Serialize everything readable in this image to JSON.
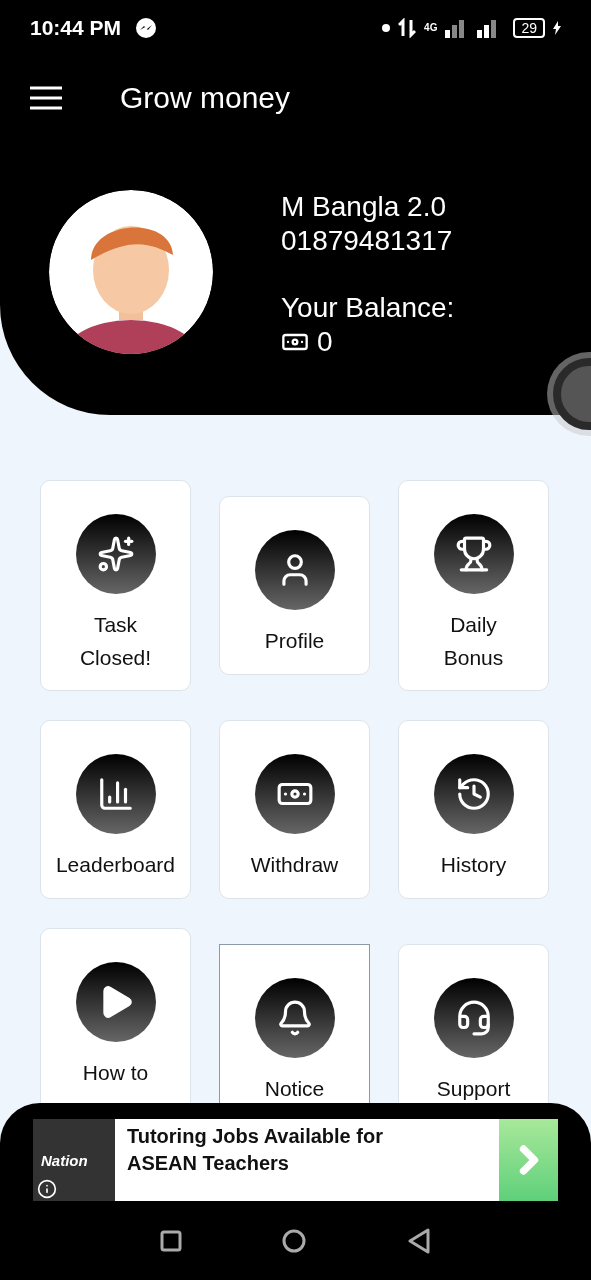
{
  "status_bar": {
    "time": "10:44 PM",
    "network": "4G",
    "battery": "29"
  },
  "app_bar": {
    "title": "Grow money"
  },
  "profile": {
    "name": "M Bangla 2.0",
    "phone": "01879481317",
    "balance_label": "Your Balance:",
    "balance": "0"
  },
  "menu": [
    {
      "label": "Task Closed!",
      "kind": "tall"
    },
    {
      "label": "Profile",
      "kind": "short"
    },
    {
      "label": "Daily Bonus",
      "kind": "tall"
    },
    {
      "label": "Leaderboard",
      "kind": "short"
    },
    {
      "label": "Withdraw",
      "kind": "short"
    },
    {
      "label": "History",
      "kind": "short"
    },
    {
      "label": "How to",
      "kind": "tall"
    },
    {
      "label": "Notice",
      "kind": "outlined"
    },
    {
      "label": "Support",
      "kind": "short"
    }
  ],
  "ad": {
    "brand": "Nation",
    "headline": "Tutoring Jobs Available for ASEAN Teachers"
  }
}
